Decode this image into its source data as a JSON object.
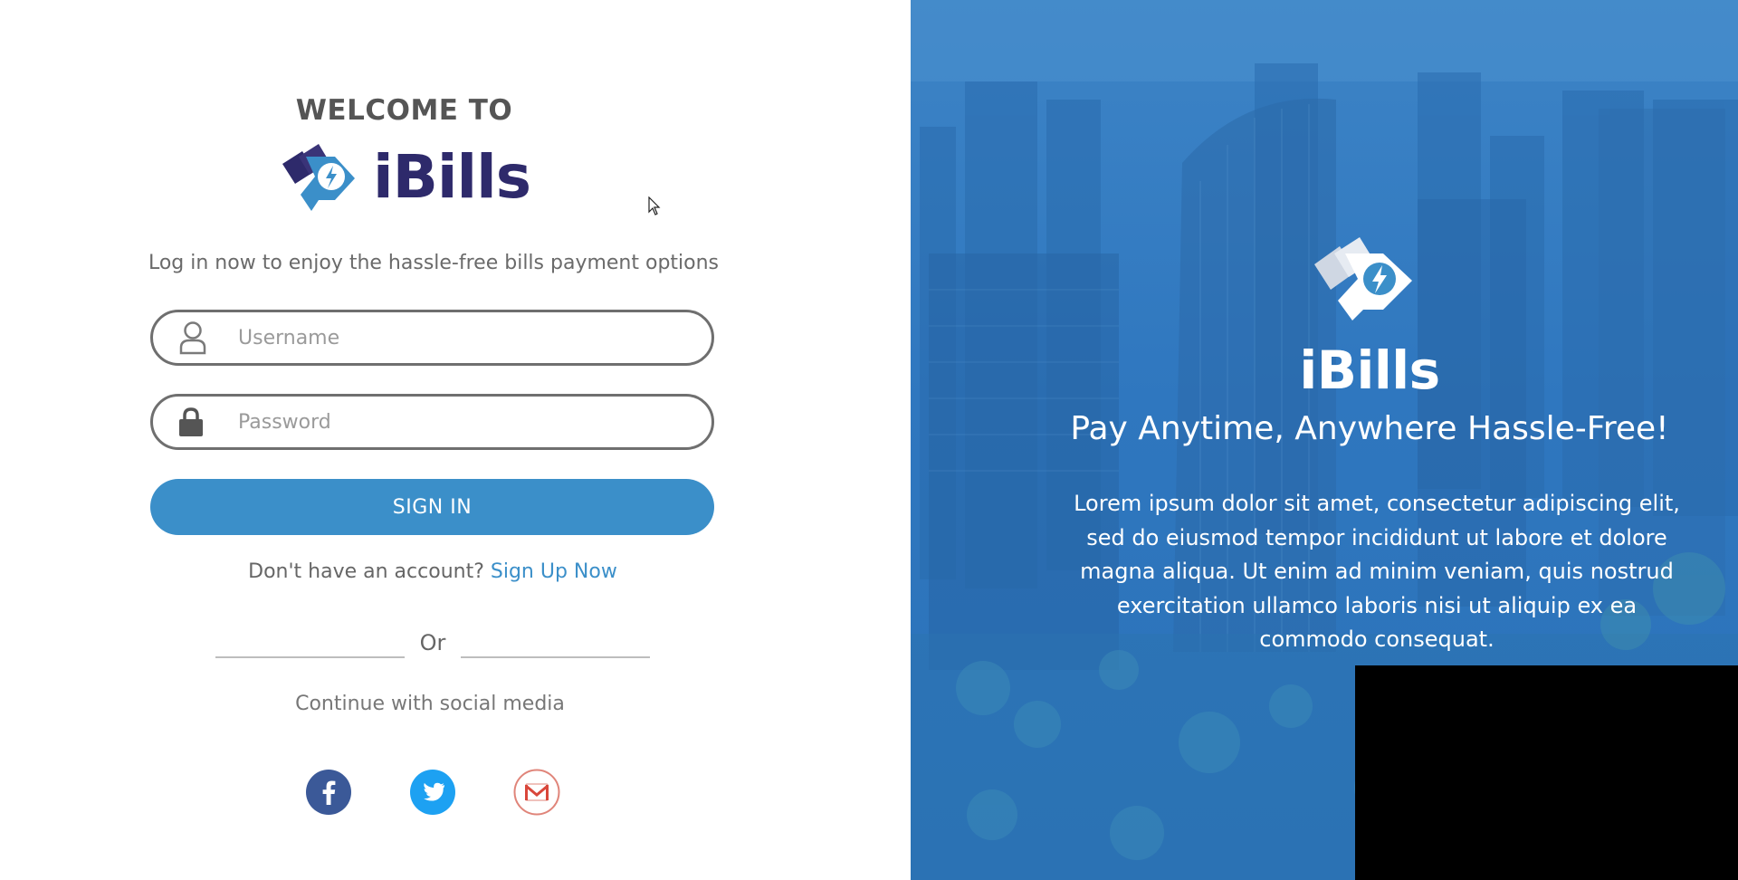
{
  "left": {
    "welcome": "WELCOME TO",
    "brand": "iBills",
    "tagline": "Log in now to enjoy the hassle-free bills payment options",
    "username": {
      "placeholder": "Username",
      "value": ""
    },
    "password": {
      "placeholder": "Password",
      "value": ""
    },
    "signin_label": "SIGN IN",
    "no_account_text": "Don't have an account? ",
    "signup_link": "Sign Up Now",
    "or_text": "Or",
    "continue_text": "Continue with social media",
    "social": [
      "facebook-icon",
      "twitter-icon",
      "gmail-icon"
    ]
  },
  "right": {
    "brand": "iBills",
    "tagline": "Pay Anytime, Anywhere Hassle-Free!",
    "body": "Lorem ipsum dolor sit amet, consectetur adipiscing elit, sed do eiusmod tempor incididunt ut labore et dolore magna aliqua. Ut enim ad minim veniam, quis nostrud exercitation ullamco laboris nisi ut aliquip ex ea commodo consequat."
  },
  "colors": {
    "accent": "#3b8fc9",
    "brand_dark": "#2e2a6b",
    "panel_blue": "#2f77bf"
  }
}
